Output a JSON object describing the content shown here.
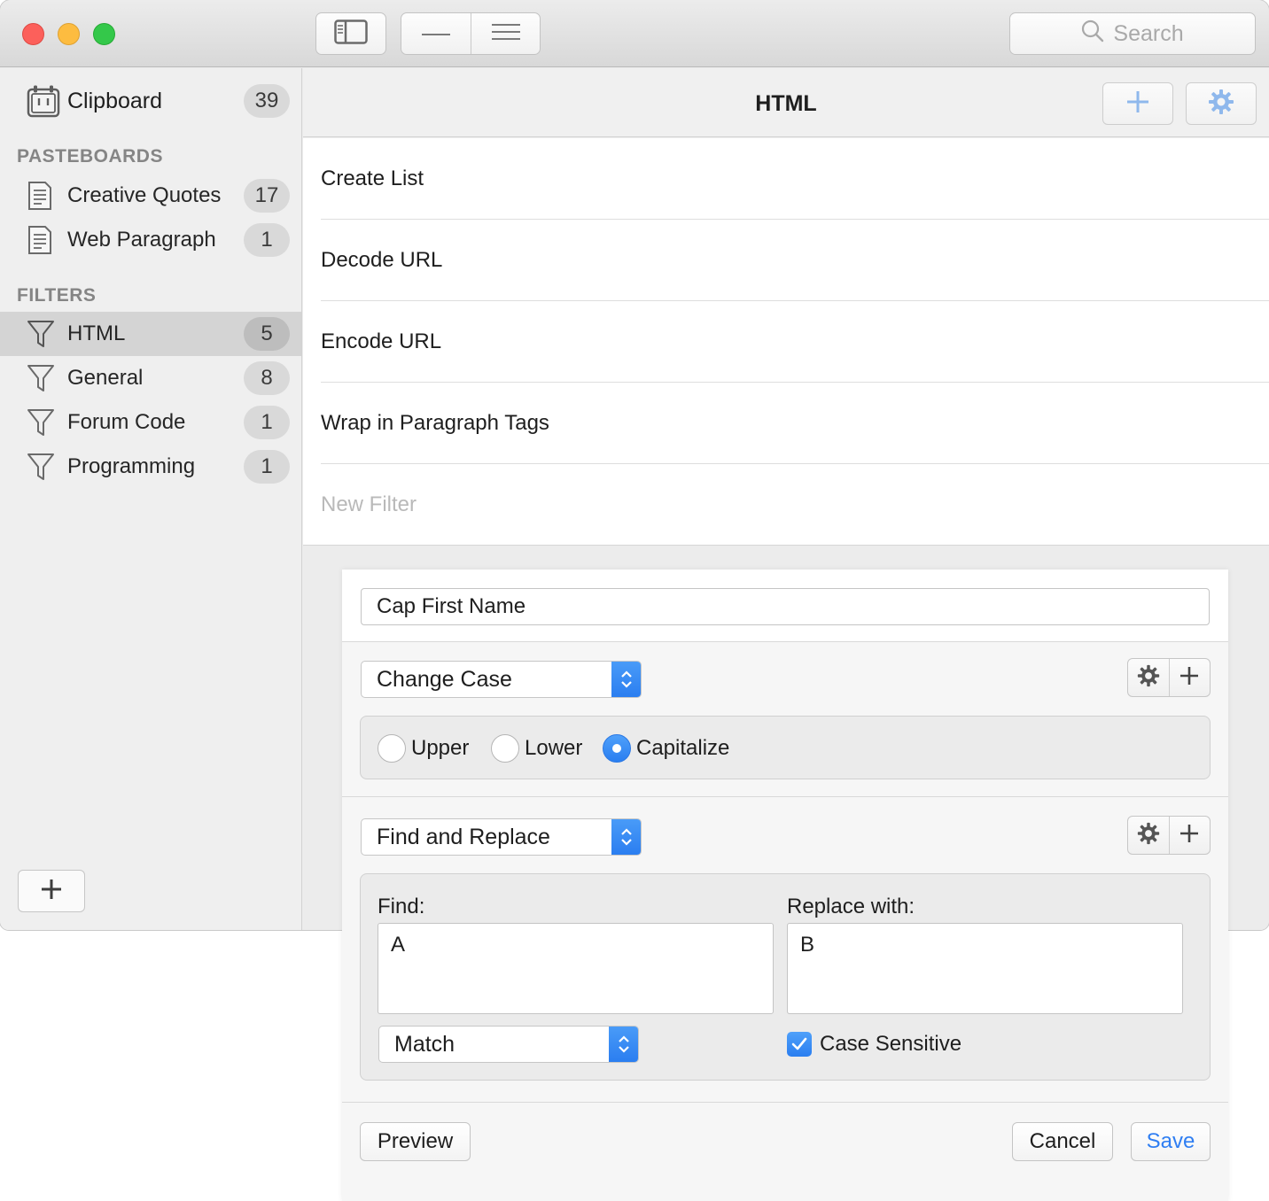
{
  "toolbar": {
    "search_placeholder": "Search"
  },
  "sidebar": {
    "clipboard": {
      "label": "Clipboard",
      "count": "39"
    },
    "pasteboards_heading": "PASTEBOARDS",
    "pasteboards": [
      {
        "label": "Creative Quotes",
        "count": "17"
      },
      {
        "label": "Web Paragraph",
        "count": "1"
      }
    ],
    "filters_heading": "FILTERS",
    "filters": [
      {
        "label": "HTML",
        "count": "5"
      },
      {
        "label": "General",
        "count": "8"
      },
      {
        "label": "Forum Code",
        "count": "1"
      },
      {
        "label": "Programming",
        "count": "1"
      }
    ]
  },
  "content": {
    "title": "HTML",
    "items": [
      "Create List",
      "Decode URL",
      "Encode URL",
      "Wrap in Paragraph Tags"
    ],
    "new_item_placeholder": "New Filter"
  },
  "editor": {
    "filter_name": "Cap First Name",
    "change_case": {
      "action": "Change Case",
      "options": [
        "Upper",
        "Lower",
        "Capitalize"
      ],
      "selected": "Capitalize"
    },
    "find_replace": {
      "action": "Find and Replace",
      "find_label": "Find:",
      "find_value": "A",
      "replace_label": "Replace with:",
      "replace_value": "B",
      "mode": "Match",
      "case_sensitive_label": "Case Sensitive",
      "case_sensitive": true
    },
    "preview_label": "Preview",
    "cancel_label": "Cancel",
    "save_label": "Save"
  },
  "colors": {
    "accent": "#2f7ef2",
    "close": "#fc605b",
    "minimize": "#fdbc40",
    "maximize": "#34c84a"
  }
}
